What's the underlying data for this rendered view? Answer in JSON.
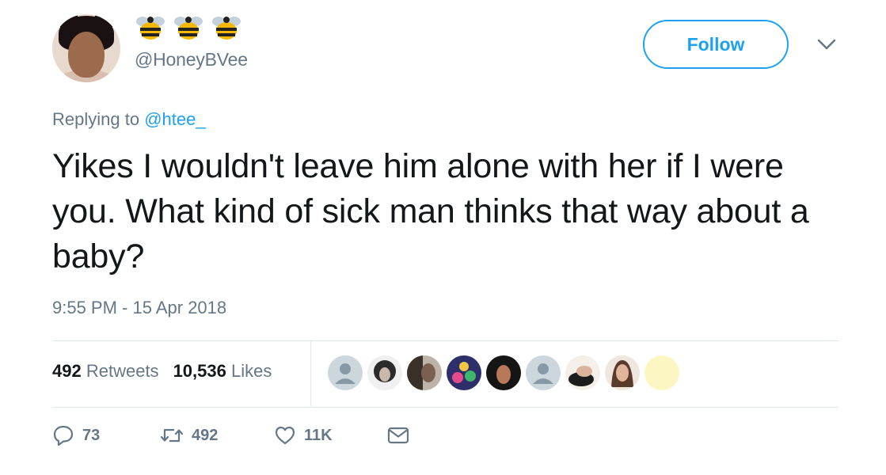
{
  "user": {
    "display_name_emoji": [
      "bee-icon",
      "bee-icon",
      "bee-icon"
    ],
    "handle": "@HoneyBVee"
  },
  "header": {
    "follow_label": "Follow"
  },
  "reply": {
    "prefix": "Replying to",
    "mention": "@htee_"
  },
  "tweet": {
    "text": "Yikes I wouldn't leave him alone with her if I were you. What kind of sick man thinks that way about a baby?",
    "timestamp": "9:55 PM - 15 Apr 2018"
  },
  "stats": {
    "retweets_count": "492",
    "retweets_label": "Retweets",
    "likes_count": "10,536",
    "likes_label": "Likes"
  },
  "likers": [
    "default-avatar",
    "photo-avatar",
    "photo-avatar",
    "photo-avatar",
    "photo-avatar",
    "default-avatar",
    "photo-avatar",
    "photo-avatar",
    "photo-avatar"
  ],
  "actions": {
    "replies": "73",
    "retweets": "492",
    "likes": "11K"
  },
  "colors": {
    "accent": "#1da1f2",
    "muted": "#657786",
    "text": "#14171a",
    "divider": "#e1e8ed"
  }
}
